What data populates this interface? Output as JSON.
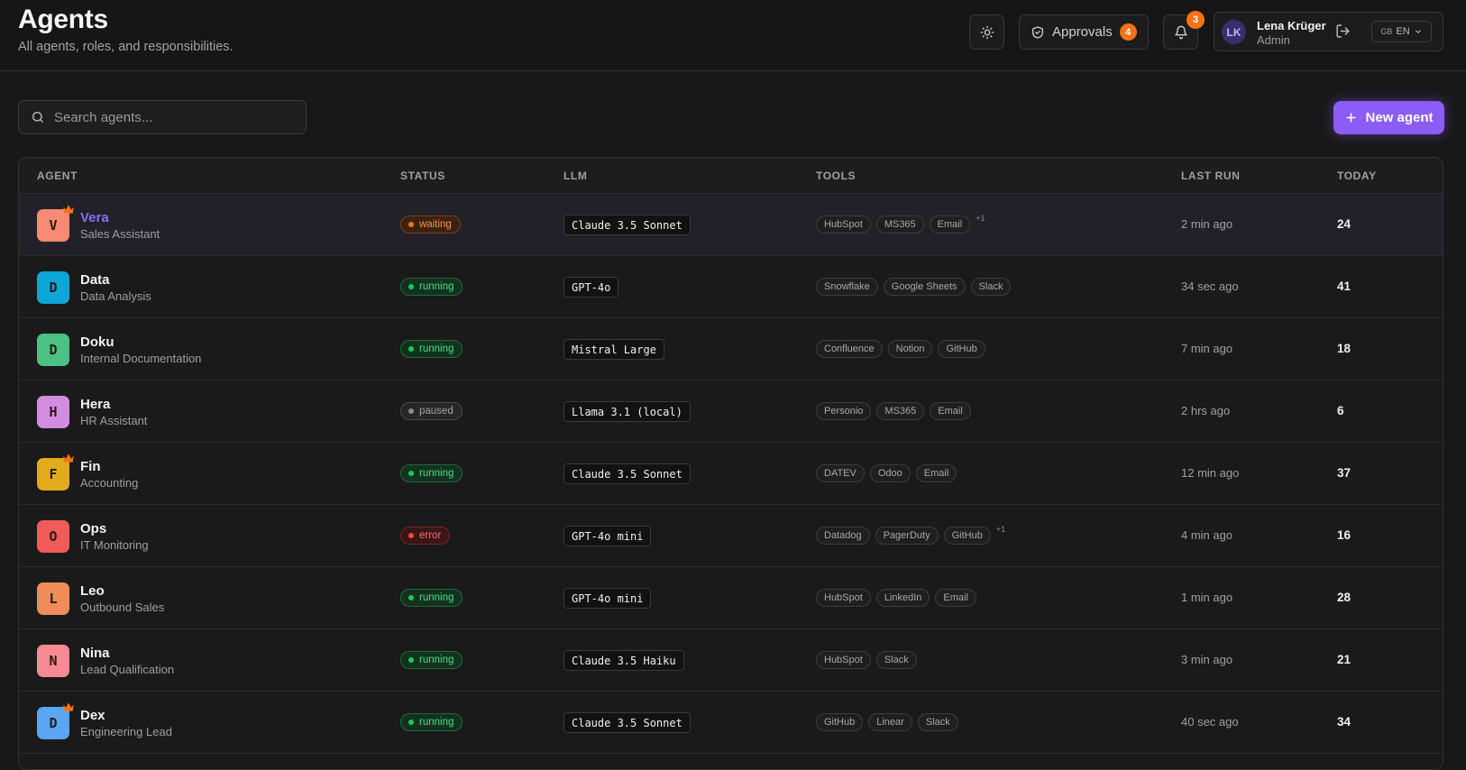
{
  "header": {
    "title": "Agents",
    "subtitle": "All agents, roles, and responsibilities.",
    "approvals_label": "Approvals",
    "approvals_count": "4",
    "notifications_count": "3",
    "user": {
      "initials": "LK",
      "name": "Lena Krüger",
      "role": "Admin"
    },
    "language": {
      "flag": "GB",
      "code": "EN"
    }
  },
  "toolbar": {
    "search_placeholder": "Search agents...",
    "new_agent_label": "New agent"
  },
  "table": {
    "columns": [
      "AGENT",
      "STATUS",
      "LLM",
      "TOOLS",
      "LAST RUN",
      "TODAY"
    ],
    "rows": [
      {
        "initial": "V",
        "name": "Vera",
        "role": "Sales Assistant",
        "lead": true,
        "color": "#f98a73",
        "status": "waiting",
        "llm": "Claude 3.5 Sonnet",
        "tools": [
          "HubSpot",
          "MS365",
          "Email"
        ],
        "more": "+1",
        "last_run": "2 min ago",
        "today": "24"
      },
      {
        "initial": "D",
        "name": "Data",
        "role": "Data Analysis",
        "lead": false,
        "color": "#0ea5d9",
        "status": "running",
        "llm": "GPT-4o",
        "tools": [
          "Snowflake",
          "Google Sheets",
          "Slack"
        ],
        "more": "",
        "last_run": "34 sec ago",
        "today": "41"
      },
      {
        "initial": "D",
        "name": "Doku",
        "role": "Internal Documentation",
        "lead": false,
        "color": "#4cc184",
        "status": "running",
        "llm": "Mistral Large",
        "tools": [
          "Confluence",
          "Notion",
          "GitHub"
        ],
        "more": "",
        "last_run": "7 min ago",
        "today": "18"
      },
      {
        "initial": "H",
        "name": "Hera",
        "role": "HR Assistant",
        "lead": false,
        "color": "#d38de0",
        "status": "paused",
        "llm": "Llama 3.1 (local)",
        "tools": [
          "Personio",
          "MS365",
          "Email"
        ],
        "more": "",
        "last_run": "2 hrs ago",
        "today": "6"
      },
      {
        "initial": "F",
        "name": "Fin",
        "role": "Accounting",
        "lead": true,
        "color": "#e2ab1c",
        "status": "running",
        "llm": "Claude 3.5 Sonnet",
        "tools": [
          "DATEV",
          "Odoo",
          "Email"
        ],
        "more": "",
        "last_run": "12 min ago",
        "today": "37"
      },
      {
        "initial": "O",
        "name": "Ops",
        "role": "IT Monitoring",
        "lead": false,
        "color": "#f35b5b",
        "status": "error",
        "llm": "GPT-4o mini",
        "tools": [
          "Datadog",
          "PagerDuty",
          "GitHub"
        ],
        "more": "+1",
        "last_run": "4 min ago",
        "today": "16"
      },
      {
        "initial": "L",
        "name": "Leo",
        "role": "Outbound Sales",
        "lead": false,
        "color": "#f08c5a",
        "status": "running",
        "llm": "GPT-4o mini",
        "tools": [
          "HubSpot",
          "LinkedIn",
          "Email"
        ],
        "more": "",
        "last_run": "1 min ago",
        "today": "28"
      },
      {
        "initial": "N",
        "name": "Nina",
        "role": "Lead Qualification",
        "lead": false,
        "color": "#f78a93",
        "status": "running",
        "llm": "Claude 3.5 Haiku",
        "tools": [
          "HubSpot",
          "Slack"
        ],
        "more": "",
        "last_run": "3 min ago",
        "today": "21"
      },
      {
        "initial": "D",
        "name": "Dex",
        "role": "Engineering Lead",
        "lead": true,
        "color": "#5aa6f5",
        "status": "running",
        "llm": "Claude 3.5 Sonnet",
        "tools": [
          "GitHub",
          "Linear",
          "Slack"
        ],
        "more": "",
        "last_run": "40 sec ago",
        "today": "34"
      }
    ]
  },
  "colors": {
    "accent": "#8b5cf6",
    "badge": "#f97316",
    "running": "#22c55e",
    "waiting": "#f97316",
    "error": "#ef4444",
    "paused": "#8a8a8a"
  },
  "icons": {
    "theme": "sun-icon",
    "approvals": "shield-check-icon",
    "notifications": "bell-icon",
    "logout": "logout-icon",
    "search": "search-icon",
    "add": "plus-icon",
    "lead": "crown-icon",
    "dropdown": "chevron-down-icon"
  }
}
